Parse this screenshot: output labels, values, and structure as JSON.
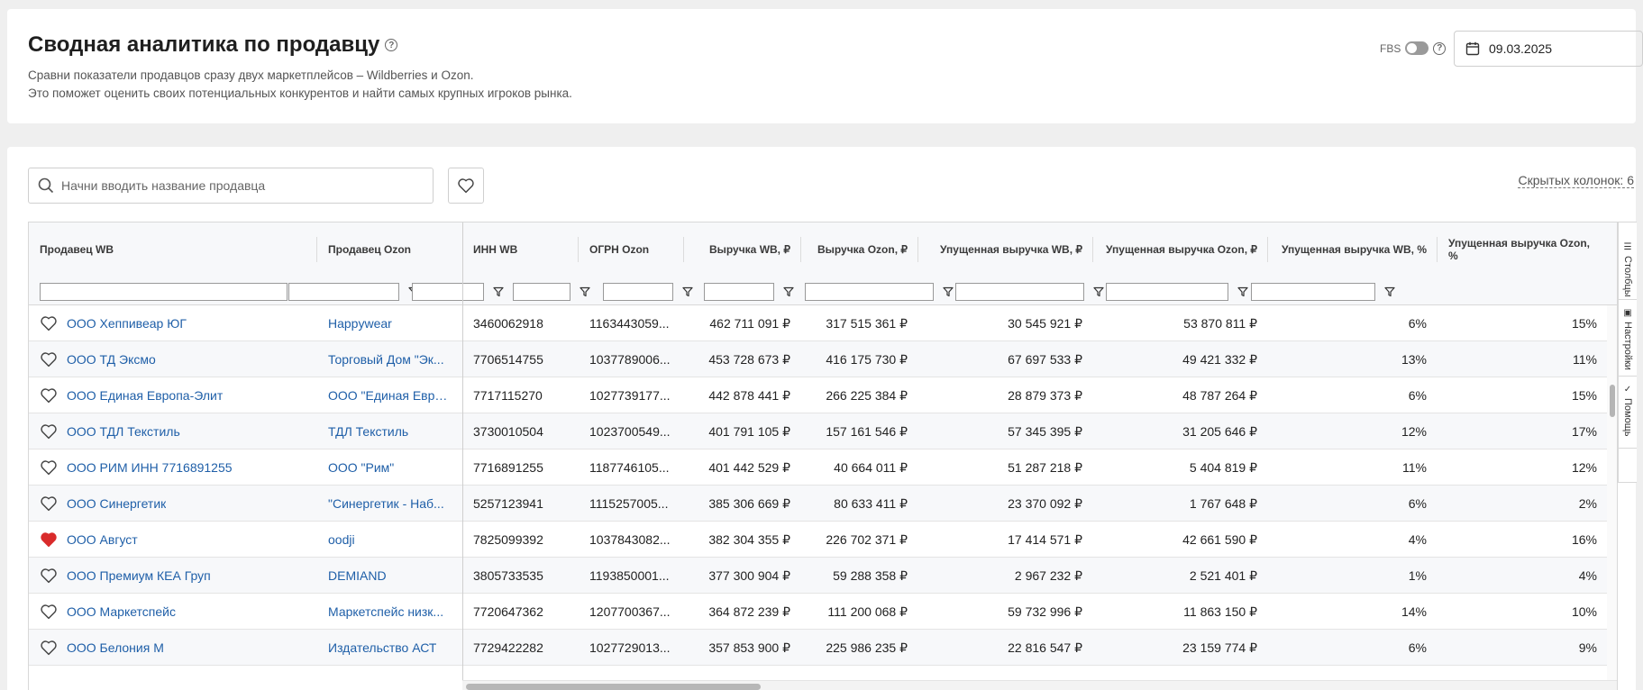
{
  "header": {
    "title": "Сводная аналитика по продавцу",
    "subtitle_line1": "Сравни показатели продавцов сразу двух маркетплейсов – Wildberries и Ozon.",
    "subtitle_line2": "Это поможет оценить своих потенциальных конкурентов и найти самых крупных игроков рынка.",
    "fbs_label": "FBS",
    "fbs_enabled": false,
    "date": "09.03.2025"
  },
  "toolbar": {
    "search_placeholder": "Начни вводить название продавца",
    "hidden_columns": "Скрытых колонок: 6"
  },
  "columns": [
    "Продавец WB",
    "Продавец Ozon",
    "ИНН WB",
    "ОГРН Ozon",
    "Выручка WB, ₽",
    "Выручка Ozon, ₽",
    "Упущенная выручка WB, ₽",
    "Упущенная выручка Ozon, ₽",
    "Упущенная выручка WB, %",
    "Упущенная выручка Ozon, %"
  ],
  "rows": [
    {
      "fav": false,
      "wb": "ООО Хеппивеар ЮГ",
      "ozon": "Happywear",
      "inn": "3460062918",
      "ogrn": "1163443059...",
      "rev_wb": "462 711 091 ₽",
      "rev_ozon": "317 515 361 ₽",
      "lost_wb": "30 545 921 ₽",
      "lost_ozon": "53 870 811 ₽",
      "lost_wb_pct": "6%",
      "lost_ozon_pct": "15%"
    },
    {
      "fav": false,
      "wb": "ООО ТД Эксмо",
      "ozon": "Торговый Дом \"Эк...",
      "inn": "7706514755",
      "ogrn": "1037789006...",
      "rev_wb": "453 728 673 ₽",
      "rev_ozon": "416 175 730 ₽",
      "lost_wb": "67 697 533 ₽",
      "lost_ozon": "49 421 332 ₽",
      "lost_wb_pct": "13%",
      "lost_ozon_pct": "11%"
    },
    {
      "fav": false,
      "wb": "ООО Единая Европа-Элит",
      "ozon": "ООО \"Единая Евро...",
      "inn": "7717115270",
      "ogrn": "1027739177...",
      "rev_wb": "442 878 441 ₽",
      "rev_ozon": "266 225 384 ₽",
      "lost_wb": "28 879 373 ₽",
      "lost_ozon": "48 787 264 ₽",
      "lost_wb_pct": "6%",
      "lost_ozon_pct": "15%"
    },
    {
      "fav": false,
      "wb": "ООО ТДЛ Текстиль",
      "ozon": "ТДЛ Текстиль",
      "inn": "3730010504",
      "ogrn": "1023700549...",
      "rev_wb": "401 791 105 ₽",
      "rev_ozon": "157 161 546 ₽",
      "lost_wb": "57 345 395 ₽",
      "lost_ozon": "31 205 646 ₽",
      "lost_wb_pct": "12%",
      "lost_ozon_pct": "17%"
    },
    {
      "fav": false,
      "wb": "ООО РИМ ИНН 7716891255",
      "ozon": "ООО \"Рим\"",
      "inn": "7716891255",
      "ogrn": "1187746105...",
      "rev_wb": "401 442 529 ₽",
      "rev_ozon": "40 664 011 ₽",
      "lost_wb": "51 287 218 ₽",
      "lost_ozon": "5 404 819 ₽",
      "lost_wb_pct": "11%",
      "lost_ozon_pct": "12%"
    },
    {
      "fav": false,
      "wb": "ООО Синергетик",
      "ozon": "\"Синергетик - Наб...",
      "inn": "5257123941",
      "ogrn": "1115257005...",
      "rev_wb": "385 306 669 ₽",
      "rev_ozon": "80 633 411 ₽",
      "lost_wb": "23 370 092 ₽",
      "lost_ozon": "1 767 648 ₽",
      "lost_wb_pct": "6%",
      "lost_ozon_pct": "2%"
    },
    {
      "fav": true,
      "wb": "ООО Август",
      "ozon": "oodji",
      "inn": "7825099392",
      "ogrn": "1037843082...",
      "rev_wb": "382 304 355 ₽",
      "rev_ozon": "226 702 371 ₽",
      "lost_wb": "17 414 571 ₽",
      "lost_ozon": "42 661 590 ₽",
      "lost_wb_pct": "4%",
      "lost_ozon_pct": "16%"
    },
    {
      "fav": false,
      "wb": "ООО Премиум КЕА Груп",
      "ozon": "DEMIAND",
      "inn": "3805733535",
      "ogrn": "1193850001...",
      "rev_wb": "377 300 904 ₽",
      "rev_ozon": "59 288 358 ₽",
      "lost_wb": "2 967 232 ₽",
      "lost_ozon": "2 521 401 ₽",
      "lost_wb_pct": "1%",
      "lost_ozon_pct": "4%"
    },
    {
      "fav": false,
      "wb": "ООО Маркетспейс",
      "ozon": "Маркетспейс низк...",
      "inn": "7720647362",
      "ogrn": "1207700367...",
      "rev_wb": "364 872 239 ₽",
      "rev_ozon": "111 200 068 ₽",
      "lost_wb": "59 732 996 ₽",
      "lost_ozon": "11 863 150 ₽",
      "lost_wb_pct": "14%",
      "lost_ozon_pct": "10%"
    },
    {
      "fav": false,
      "wb": "ООО Белония М",
      "ozon": "Издательство АСТ",
      "inn": "7729422282",
      "ogrn": "1027729013...",
      "rev_wb": "357 853 900 ₽",
      "rev_ozon": "225 986 235 ₽",
      "lost_wb": "22 816 547 ₽",
      "lost_ozon": "23 159 774 ₽",
      "lost_wb_pct": "6%",
      "lost_ozon_pct": "9%"
    }
  ],
  "side_tabs": [
    "Столбцы",
    "Настройки",
    "Помощь"
  ],
  "colors": {
    "link": "#1f5fa8",
    "heart_active": "#d92b2b"
  }
}
